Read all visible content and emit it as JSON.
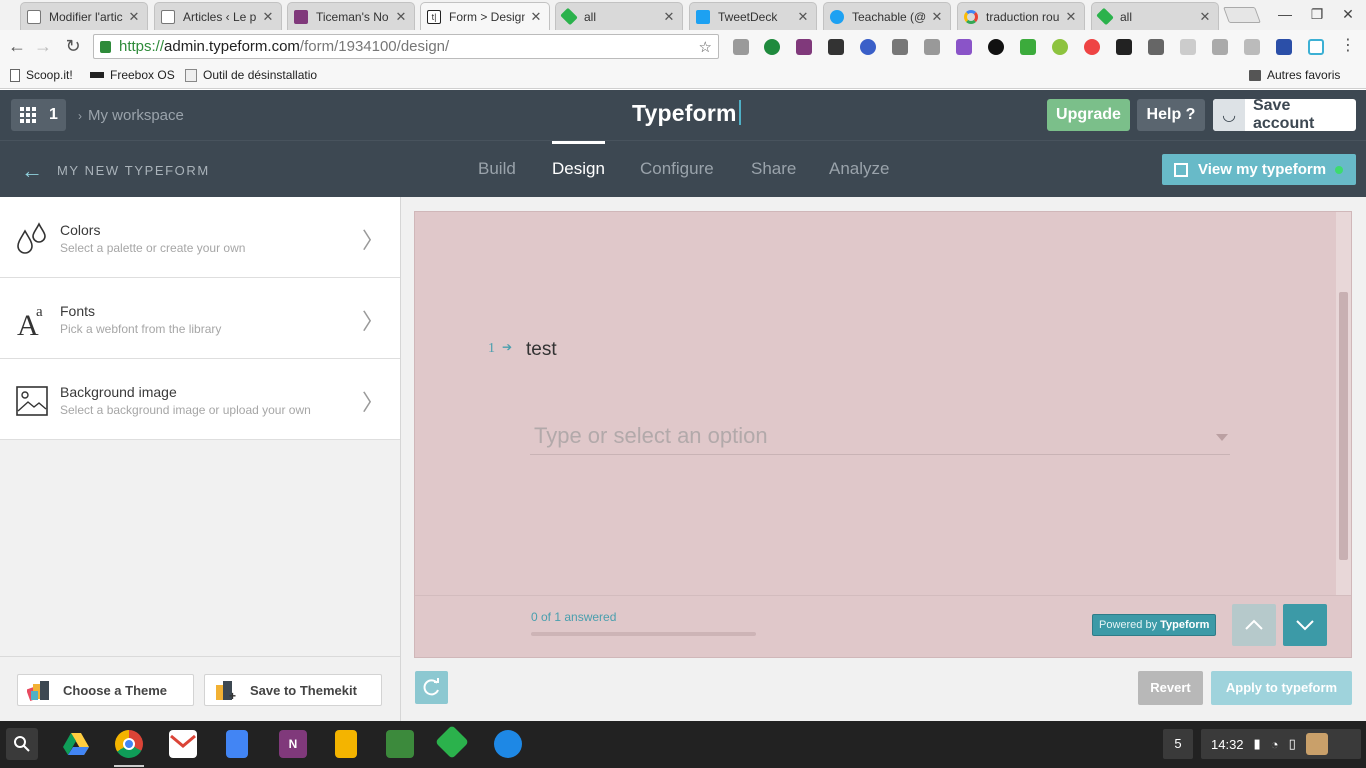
{
  "browser": {
    "tabs": [
      {
        "label": "Modifier l'artic",
        "icon": "page-icon",
        "color": "#ffffff"
      },
      {
        "label": "Articles ‹ Le p",
        "icon": "page-icon",
        "color": "#ffffff"
      },
      {
        "label": "Ticeman's No",
        "icon": "onenote-icon",
        "color": "#80397b"
      },
      {
        "label": "Form > Design",
        "icon": "typeform-icon",
        "color": "#222222"
      },
      {
        "label": "all",
        "icon": "feedly-icon",
        "color": "#2bb24c"
      },
      {
        "label": "TweetDeck",
        "icon": "tweetdeck-icon",
        "color": "#1da1f2"
      },
      {
        "label": "Teachable (@",
        "icon": "twitter-icon",
        "color": "#1da1f2"
      },
      {
        "label": "traduction rou",
        "icon": "google-icon",
        "color": "#4285f4"
      },
      {
        "label": "all",
        "icon": "feedly-icon",
        "color": "#2bb24c"
      }
    ],
    "url": {
      "protocol": "https://",
      "host": "admin.typeform.com",
      "path": "/form/1934100/design/"
    },
    "bookmarks": [
      {
        "label": "Scoop.it!",
        "icon": "page-icon"
      },
      {
        "label": "Freebox OS",
        "icon": "freebox-icon"
      },
      {
        "label": "Outil de désinstallatio",
        "icon": "tool-icon"
      },
      {
        "label": "Autres favoris",
        "icon": "folder-icon"
      }
    ]
  },
  "header": {
    "apps_count": "1",
    "breadcrumb": "My workspace",
    "logo": "Typeform",
    "upgrade": "Upgrade",
    "help": "Help ?",
    "save_account": "Save account"
  },
  "subheader": {
    "form_name": "MY NEW TYPEFORM",
    "tabs": [
      "Build",
      "Design",
      "Configure",
      "Share",
      "Analyze"
    ],
    "active_tab": "Design",
    "view_button": "View my typeform"
  },
  "sidebar": {
    "items": [
      {
        "title": "Colors",
        "subtitle": "Select a palette or create your own",
        "icon": "drops-icon"
      },
      {
        "title": "Fonts",
        "subtitle": "Pick a webfont from the library",
        "icon": "font-icon"
      },
      {
        "title": "Background image",
        "subtitle": "Select a background image or upload your own",
        "icon": "image-icon"
      }
    ],
    "choose_theme": "Choose a Theme",
    "save_themekit": "Save to Themekit"
  },
  "preview": {
    "question_number": "1",
    "question_text": "test",
    "dropdown_placeholder": "Type or select an option",
    "answered_text": "0 of 1 answered",
    "progress": 0,
    "powered_prefix": "Powered by",
    "powered_brand": "Typeform",
    "background_color": "#e0c8ca",
    "accent_color": "#3c9aa7"
  },
  "actions": {
    "revert": "Revert",
    "apply": "Apply to typeform"
  },
  "shelf": {
    "notification_count": "5",
    "time": "14:32",
    "apps": [
      "drive-icon",
      "chrome-icon",
      "gmail-icon",
      "docs-icon",
      "onenote-icon",
      "slides-icon",
      "pencil-app-icon",
      "feedly-icon",
      "files-icon"
    ]
  }
}
